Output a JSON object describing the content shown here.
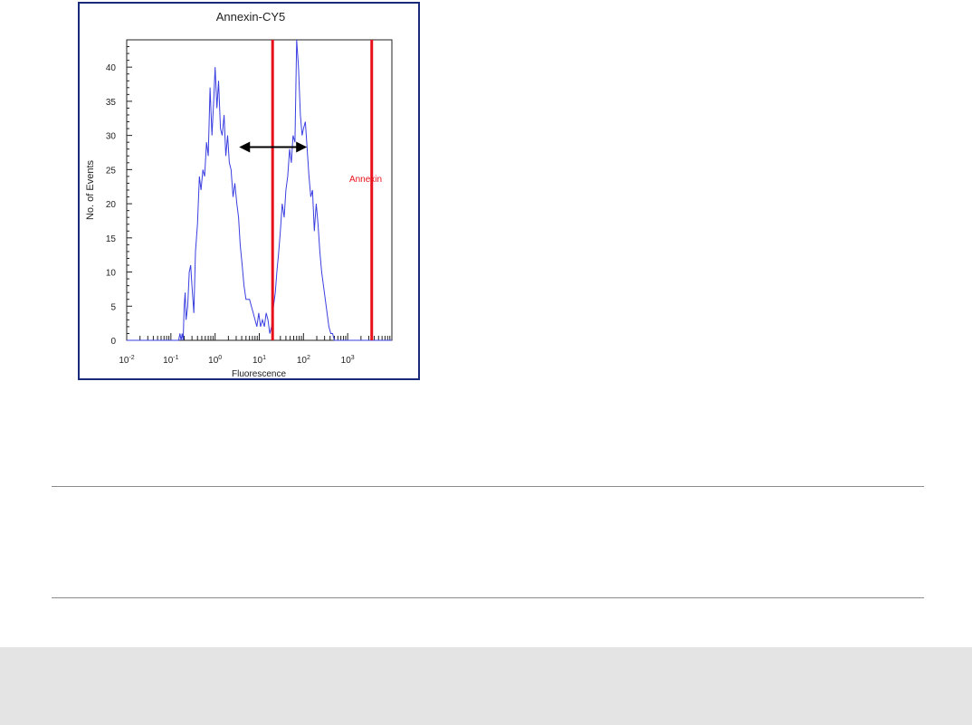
{
  "colors": {
    "frame_border": "#1a2a7a",
    "histogram_line": "#3a3fe0",
    "gate_line": "#e8101a",
    "arrow": "#000000",
    "footer_band": "#e4e4e4",
    "divider": "#8c8c8c"
  },
  "chart_data": {
    "type": "line",
    "title": "Annexin-CY5",
    "xlabel": "Fluorescence",
    "ylabel": "No. of Events",
    "x_scale": "log",
    "xlim": [
      0.01,
      10000
    ],
    "ylim": [
      0,
      44
    ],
    "x_ticks": [
      {
        "base": "10",
        "exp": "-2",
        "value": 0.01
      },
      {
        "base": "10",
        "exp": "-1",
        "value": 0.1
      },
      {
        "base": "10",
        "exp": "0",
        "value": 1
      },
      {
        "base": "10",
        "exp": "1",
        "value": 10
      },
      {
        "base": "10",
        "exp": "2",
        "value": 100
      },
      {
        "base": "10",
        "exp": "3",
        "value": 1000
      }
    ],
    "y_ticks": [
      0,
      5,
      10,
      15,
      20,
      25,
      30,
      35,
      40
    ],
    "series": [
      {
        "x": [
          0.01,
          0.011,
          0.15,
          0.16,
          0.17,
          0.18,
          0.19,
          0.2,
          0.21,
          0.22,
          0.24,
          0.26,
          0.28,
          0.3,
          0.33,
          0.36,
          0.4,
          0.44,
          0.48,
          0.53,
          0.58,
          0.64,
          0.7,
          0.77,
          0.85,
          0.93,
          1.0,
          1.1,
          1.2,
          1.32,
          1.45,
          1.6,
          1.75,
          1.92,
          2.1,
          2.3,
          2.55,
          2.8,
          3.1,
          3.4,
          3.7,
          4.1,
          4.5,
          5.0,
          5.5,
          6.0,
          6.6,
          7.3,
          8.0,
          8.8,
          9.7,
          10.7,
          11.8,
          13,
          14.3,
          15.7,
          17.3,
          19,
          21,
          23,
          25,
          27.5,
          30,
          33,
          36.5,
          40,
          44,
          48.5,
          53,
          58,
          64,
          70,
          77,
          85,
          93,
          100,
          110,
          121,
          133,
          146,
          160,
          176,
          194,
          213,
          234,
          257,
          283,
          311,
          342,
          376,
          414,
          455,
          500,
          550,
          10000
        ],
        "values": [
          0,
          0,
          0,
          1,
          0,
          1,
          0,
          5,
          7,
          3,
          5,
          10,
          11,
          8,
          4,
          13,
          17,
          24,
          22,
          25,
          24,
          29,
          27,
          37,
          30,
          35,
          40,
          34,
          38,
          31,
          30,
          33,
          27,
          30,
          26,
          25,
          21,
          23,
          20,
          18,
          14,
          11,
          8,
          6,
          6,
          6,
          5,
          4,
          3,
          2,
          4,
          2,
          3,
          2,
          4,
          3,
          1,
          2,
          5,
          7,
          10,
          13,
          16,
          20,
          18,
          22,
          24,
          28,
          26,
          30,
          29,
          44,
          40,
          33,
          30,
          31,
          32,
          28,
          24,
          21,
          22,
          16,
          20,
          17,
          13,
          10,
          8,
          6,
          4,
          2,
          1,
          1,
          0,
          0,
          0
        ]
      }
    ],
    "gates": [
      {
        "x": 20.0,
        "label": ""
      },
      {
        "x": 3500,
        "label": "Annexin"
      }
    ],
    "annotations": [
      {
        "type": "double-arrow",
        "x_from": 3.5,
        "x_to": 120,
        "y": 28.3
      }
    ]
  }
}
